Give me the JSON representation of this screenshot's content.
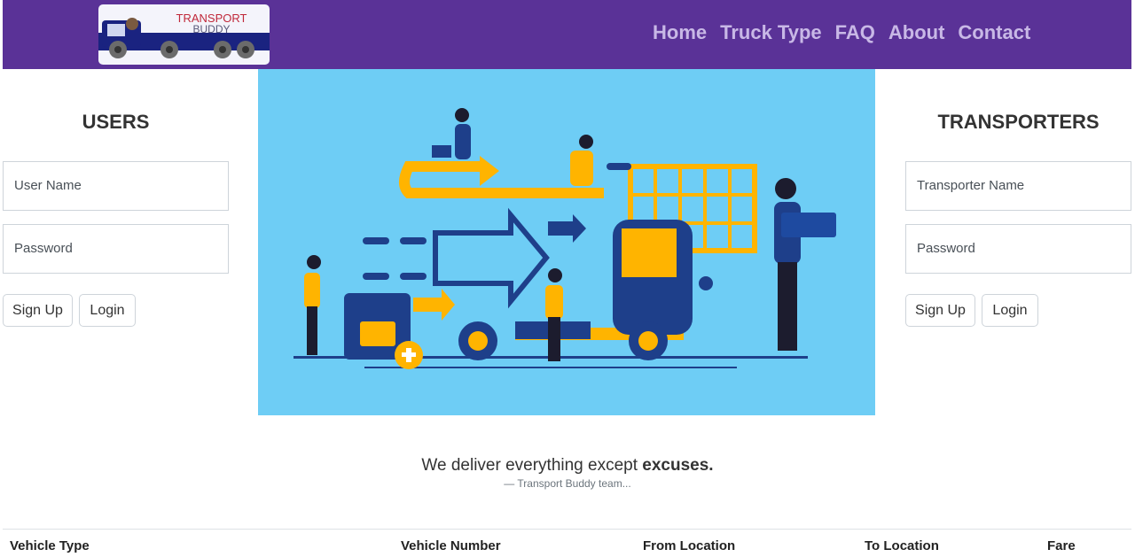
{
  "brand": {
    "line1": "TRANSPORT",
    "line2": "BUDDY"
  },
  "nav": [
    "Home",
    "Truck Type",
    "FAQ",
    "About",
    "Contact"
  ],
  "users": {
    "title": "USERS",
    "username_placeholder": "User Name",
    "password_placeholder": "Password",
    "signup_label": "Sign Up",
    "login_label": "Login"
  },
  "transporters": {
    "title": "TRANSPORTERS",
    "name_placeholder": "Transporter Name",
    "password_placeholder": "Password",
    "signup_label": "Sign Up",
    "login_label": "Login"
  },
  "quote": {
    "text_start": "We deliver everything except ",
    "text_emph": "excuses.",
    "footer": "— Transport Buddy team..."
  },
  "table": {
    "headers": [
      "Vehicle Type",
      "Vehicle Number",
      "From Location",
      "To Location",
      "Fare"
    ]
  },
  "colors": {
    "navbar": "#5a3297",
    "hero_bg": "#6ecdf5",
    "accent_yellow": "#ffb400",
    "accent_navy": "#1e3f8a"
  }
}
